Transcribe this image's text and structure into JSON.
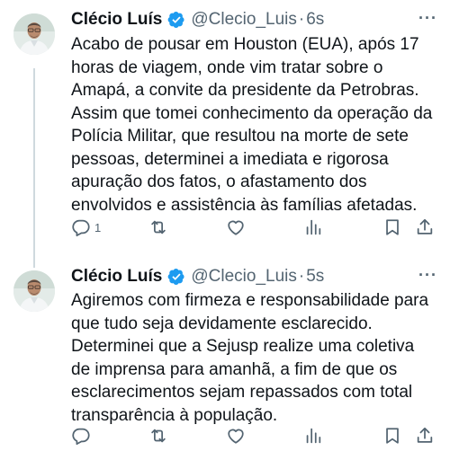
{
  "colors": {
    "accent": "#1d9bf0",
    "text": "#0f1419",
    "muted": "#536471",
    "thread_line": "#cfd9de"
  },
  "tweets": [
    {
      "author": "Clécio Luís",
      "handle": "@Clecio_Luis",
      "separator": "·",
      "time": "6s",
      "more": "···",
      "verified_icon": "verified-badge-icon",
      "lines": [
        "Acabo de pousar em Houston (EUA), após 17",
        "horas de viagem, onde vim tratar sobre o",
        "Amapá, a convite da presidente da Petrobras.",
        "Assim que tomei conhecimento da operação da",
        "Polícia Militar, que resultou na morte de sete",
        "pessoas, determinei a imediata e rigorosa",
        "apuração dos fatos, o afastamento dos",
        "envolvidos e assistência às famílias afetadas."
      ],
      "reply_count": "1",
      "retweet_count": "",
      "like_count": "",
      "view_count": ""
    },
    {
      "author": "Clécio Luís",
      "handle": "@Clecio_Luis",
      "separator": "·",
      "time": "5s",
      "more": "···",
      "verified_icon": "verified-badge-icon",
      "lines": [
        "Agiremos com firmeza e responsabilidade para",
        "que tudo seja devidamente esclarecido.",
        "Determinei que a Sejusp realize uma coletiva",
        "de imprensa para amanhã, a fim de que os",
        "esclarecimentos sejam repassados com total",
        "transparência à população."
      ],
      "reply_count": "",
      "retweet_count": "",
      "like_count": "",
      "view_count": ""
    }
  ]
}
